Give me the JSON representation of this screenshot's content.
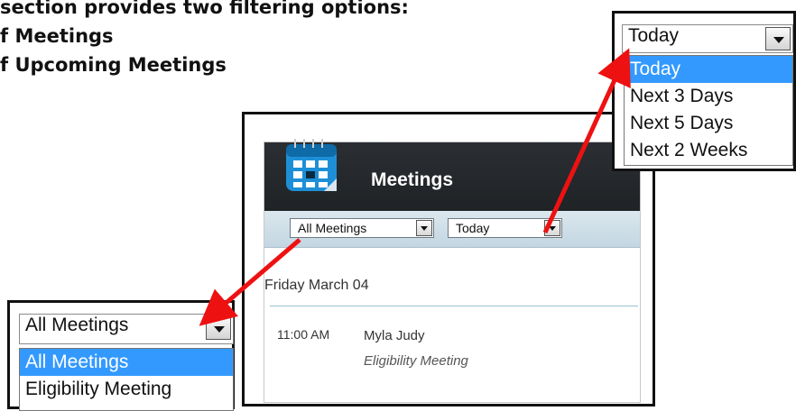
{
  "intro": {
    "line1": "section provides two filtering options:",
    "line2": "f Meetings",
    "line3": "f Upcoming Meetings"
  },
  "widget": {
    "title": "Meetings",
    "filter_meetings": "All Meetings",
    "filter_range": "Today",
    "date_heading": "Friday March 04",
    "meeting": {
      "time": "11:00 AM",
      "name": "Myla Judy",
      "type": "Eligibility Meeting"
    }
  },
  "range_callout": {
    "selected": "Today",
    "options": [
      "Today",
      "Next 3 Days",
      "Next 5 Days",
      "Next 2 Weeks"
    ],
    "highlighted_index": 0
  },
  "meetings_callout": {
    "selected": "All Meetings",
    "options": [
      "All Meetings",
      "Eligibility Meeting"
    ],
    "highlighted_index": 0
  },
  "colors": {
    "highlight": "#3399ff",
    "arrow": "#ee1111",
    "header": "#24282b"
  }
}
